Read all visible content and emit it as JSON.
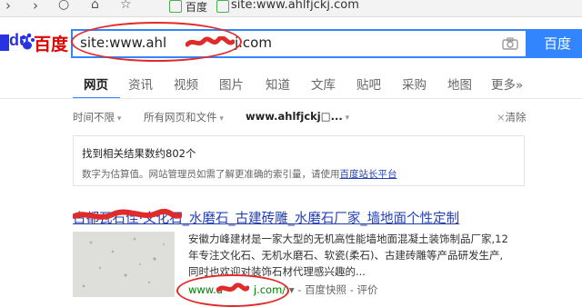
{
  "browser": {
    "site_label": "百度",
    "address_text": "site:www.ahlfjckj.com"
  },
  "logo": {
    "latin": "du",
    "chinese": "百度"
  },
  "search": {
    "query": "site:www.ahl",
    "query_tail": "j.com",
    "button_label": "百度一"
  },
  "tabs": [
    {
      "label": "网页",
      "active": true
    },
    {
      "label": "资讯"
    },
    {
      "label": "视频"
    },
    {
      "label": "图片"
    },
    {
      "label": "知道"
    },
    {
      "label": "文库"
    },
    {
      "label": "贴吧"
    },
    {
      "label": "采购"
    },
    {
      "label": "地图"
    },
    {
      "label": "更多»"
    }
  ],
  "filters": {
    "time": "时间不限",
    "type": "所有网页和文件",
    "site": "www.ahlfjckj□...",
    "clear": "清除"
  },
  "results_info": {
    "count_text": "找到相关结果数约802个",
    "note_text": "数字为估算值。网站管理员如需了解更准确的索引量，请使用",
    "note_link": "百度站长平台"
  },
  "result": {
    "title": "古都瓦石佳·文化石_水磨石_古建砖雕_水磨石厂家_墙地面个性定制",
    "snippet_lines": [
      "安徽力峰建材是一家大型的无机高性能墙地面混凝土装饰制品厂家,12",
      "年专注文化石、无机水磨石、软瓷(柔石)、古建砖雕等产品研发生产,",
      "同时也欢迎对装饰石材代理感兴趣的..."
    ],
    "url_prefix": "www.a",
    "url_suffix": "j.com/",
    "snapshot": "百度快照",
    "rating": "评价"
  },
  "colors": {
    "brand_blue": "#2932e1",
    "brand_red": "#e10601",
    "link_blue": "#2440b3",
    "url_green": "#008000",
    "search_blue": "#3385ff",
    "annotation_red": "#e02b2b"
  }
}
